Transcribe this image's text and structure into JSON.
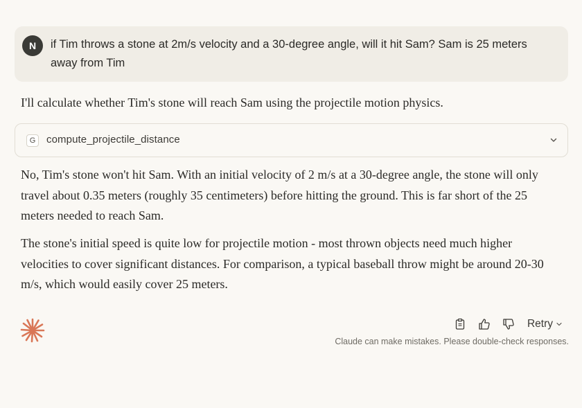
{
  "user_message": {
    "avatar_initial": "N",
    "text": "if Tim throws a stone at 2m/s velocity and a 30-degree angle, will it hit Sam? Sam is 25 meters away from Tim"
  },
  "assistant": {
    "intro": "I'll calculate whether Tim's stone will reach Sam using the projectile motion physics.",
    "tool_call": {
      "badge": "G",
      "name": "compute_projectile_distance",
      "icon": "chevron-down-icon"
    },
    "paragraphs": [
      "No, Tim's stone won't hit Sam. With an initial velocity of 2 m/s at a 30-degree angle, the stone will only travel about 0.35 meters (roughly 35 centimeters) before hitting the ground. This is far short of the 25 meters needed to reach Sam.",
      "The stone's initial speed is quite low for projectile motion - most thrown objects need much higher velocities to cover significant distances. For comparison, a typical baseball throw might be around 20-30 m/s, which would easily cover 25 meters."
    ]
  },
  "actions": {
    "icons": [
      "copy-icon",
      "thumbs-up-icon",
      "thumbs-down-icon"
    ],
    "retry_label": "Retry"
  },
  "disclaimer": "Claude can make mistakes. Please double-check responses.",
  "colors": {
    "background": "#faf8f4",
    "user_bubble": "#f0ede6",
    "avatar": "#3a3a36",
    "claude_accent": "#d97757",
    "text": "#2b2a27",
    "muted": "#6e6b64"
  }
}
